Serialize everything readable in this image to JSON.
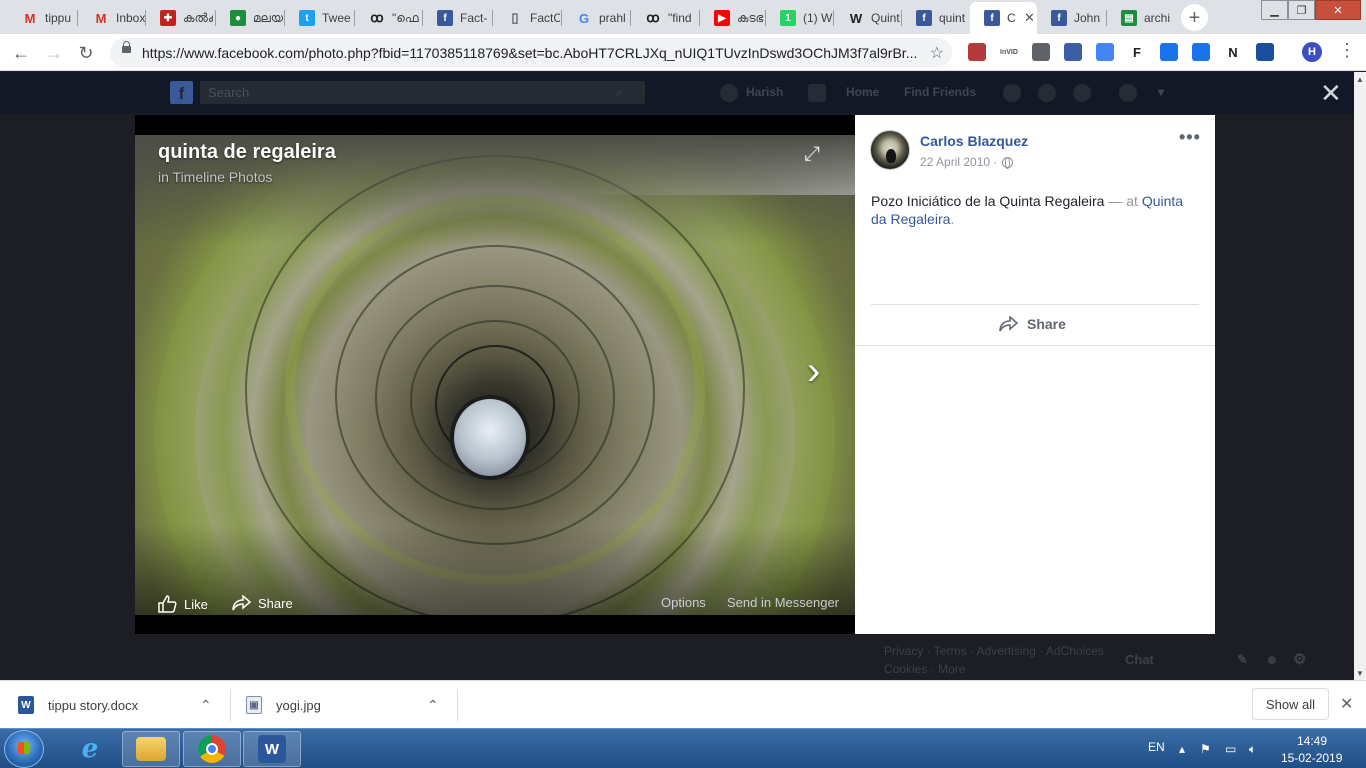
{
  "browser": {
    "tabs": [
      {
        "label": "tippu",
        "icon": "gmail-icon",
        "color": "#d93025"
      },
      {
        "label": "Inbox",
        "icon": "gmail-icon",
        "color": "#d93025"
      },
      {
        "label": "കൽക",
        "icon": "puzzle-icon",
        "color": "#c5221f"
      },
      {
        "label": "മലയാ",
        "icon": "green-circle-icon",
        "color": "#1e8e3e"
      },
      {
        "label": "Twee",
        "icon": "twitter-icon",
        "color": "#1da1f2"
      },
      {
        "label": "\"ഫെ",
        "icon": "loop-icon",
        "color": "#202124"
      },
      {
        "label": "Fact-",
        "icon": "facebook-icon",
        "color": "#3b5998"
      },
      {
        "label": "FactC",
        "icon": "document-icon",
        "color": "#5f6368"
      },
      {
        "label": "prahl",
        "icon": "google-icon",
        "color": "#4285f4"
      },
      {
        "label": "\"find",
        "icon": "loop-icon",
        "color": "#202124"
      },
      {
        "label": "കടഭ",
        "icon": "youtube-icon",
        "color": "#ff0000"
      },
      {
        "label": "(1) W",
        "icon": "whatsapp-icon",
        "color": "#25d366"
      },
      {
        "label": "Quint",
        "icon": "wikipedia-icon",
        "color": "#202124"
      },
      {
        "label": "quint",
        "icon": "facebook-icon",
        "color": "#3b5998"
      },
      {
        "label": "C",
        "icon": "facebook-icon",
        "color": "#3b5998",
        "active": true
      },
      {
        "label": "John",
        "icon": "facebook-icon",
        "color": "#3b5998"
      },
      {
        "label": "archi",
        "icon": "archive-icon",
        "color": "#1e8e3e"
      }
    ],
    "active_tab_close": "✕",
    "new_tab": "+",
    "url": "https://www.facebook.com/photo.php?fbid=1170385118769&set=bc.AboHT7CRLJXq_nUIQ1TUvzInDswd3OChJM3f7al9rBr...",
    "profile_initial": "H",
    "extensions": [
      {
        "icon": "pdf-extension-icon",
        "text": "",
        "color": "#b33b3b"
      },
      {
        "icon": "invid-extension-icon",
        "text": "InVID",
        "color": "#555555"
      },
      {
        "icon": "camera-extension-icon",
        "text": "",
        "color": "#5f6368"
      },
      {
        "icon": "photo-extension-icon",
        "text": "",
        "color": "#3c5ea8"
      },
      {
        "icon": "translate-extension-icon",
        "text": "",
        "color": "#4285f4"
      },
      {
        "icon": "f-extension-icon",
        "text": "F",
        "color": "#202124"
      },
      {
        "icon": "eye-extension-icon",
        "text": "",
        "color": "#1a73e8"
      },
      {
        "icon": "window-extension-icon",
        "text": "",
        "color": "#1a73e8"
      },
      {
        "icon": "n-extension-icon",
        "text": "N",
        "color": "#202124"
      },
      {
        "icon": "bookmark-extension-icon",
        "text": "",
        "color": "#1a4fa0"
      }
    ]
  },
  "facebook": {
    "search_placeholder": "Search",
    "user_name": "Harish",
    "nav_home": "Home",
    "nav_find_friends": "Find Friends",
    "footer_links": [
      "Privacy",
      "Terms",
      "Advertising",
      "AdChoices",
      "Cookies",
      "More"
    ],
    "chat_label": "Chat"
  },
  "photo": {
    "title": "quinta de regaleira",
    "album": "in Timeline Photos",
    "actions": {
      "like": "Like",
      "share": "Share",
      "options": "Options",
      "send": "Send in Messenger"
    }
  },
  "post": {
    "author": "Carlos Blazquez",
    "date": "22 April 2010 ·",
    "caption": "Pozo Iniciático de la Quinta Regaleira",
    "at_text": "— at",
    "place": "Quinta da Regaleira",
    "place_suffix": ".",
    "share_label": "Share"
  },
  "downloads": {
    "items": [
      {
        "name": "tippu story.docx",
        "icon": "word-doc-icon"
      },
      {
        "name": "yogi.jpg",
        "icon": "image-file-icon"
      }
    ],
    "show_all": "Show all"
  },
  "taskbar": {
    "apps": [
      {
        "icon": "internet-explorer-icon"
      },
      {
        "icon": "file-explorer-icon"
      },
      {
        "icon": "chrome-icon"
      },
      {
        "icon": "word-icon"
      }
    ],
    "language": "EN",
    "time": "14:49",
    "date": "15-02-2019"
  }
}
